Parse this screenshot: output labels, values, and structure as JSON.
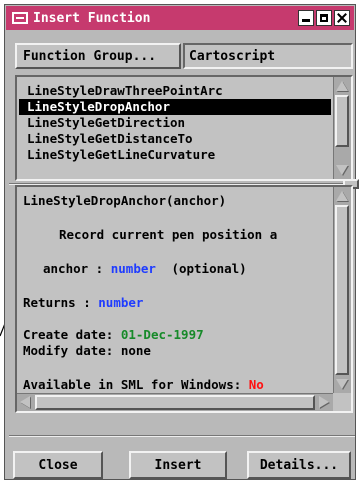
{
  "window": {
    "title": "Insert Function",
    "accent": "#c63a6e"
  },
  "function_group": {
    "button_label": "Function Group...",
    "value": "Cartoscript"
  },
  "function_list": {
    "items": [
      "LineStyleDrawThreePointArc",
      "LineStyleDropAnchor",
      "LineStyleGetDirection",
      "LineStyleGetDistanceTo",
      "LineStyleGetLineCurvature"
    ],
    "selected": "LineStyleDropAnchor"
  },
  "description": {
    "signature": "LineStyleDropAnchor(anchor)",
    "summary": "Record current pen position a",
    "param_name": "anchor :",
    "param_type": "number",
    "param_note": "(optional)",
    "returns_label": "Returns :",
    "returns_type": "number",
    "create_label": "Create date:",
    "create_date": "01-Dec-1997",
    "modify_label": "Modify date:",
    "modify_date": "none",
    "availability_label": "Available in SML for Windows:",
    "availability_value": "No"
  },
  "buttons": {
    "close": "Close",
    "insert": "Insert",
    "details": "Details..."
  }
}
